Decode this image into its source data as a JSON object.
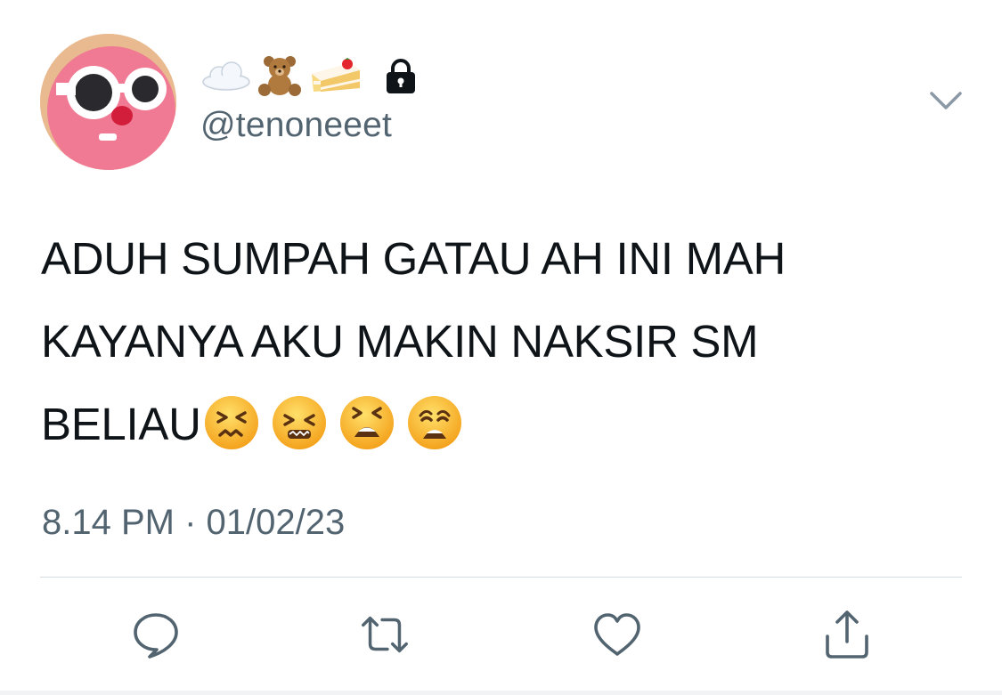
{
  "tweet": {
    "display_name_emoji": [
      "cloud-emoji",
      "teddy-bear-emoji",
      "shortcake-emoji"
    ],
    "protected_icon": "lock-icon",
    "handle": "@tenoneeet",
    "text_lines": [
      "ADUH SUMPAH GATAU AH INI MAH",
      "KAYANYA AKU MAKIN NAKSIR SM",
      "BELIAU"
    ],
    "trailing_emoji": [
      "confounded-face-emoji",
      "persevering-face-emoji",
      "tired-face-emoji",
      "weary-face-emoji"
    ],
    "timestamp": "8.14 PM · 01/02/23"
  },
  "actions": {
    "reply_icon": "reply-icon",
    "retweet_icon": "retweet-icon",
    "like_icon": "heart-icon",
    "share_icon": "share-icon"
  },
  "colors": {
    "text_primary": "#0f1419",
    "text_secondary": "#536471",
    "divider": "#d5dbe0",
    "icon": "#536471"
  }
}
